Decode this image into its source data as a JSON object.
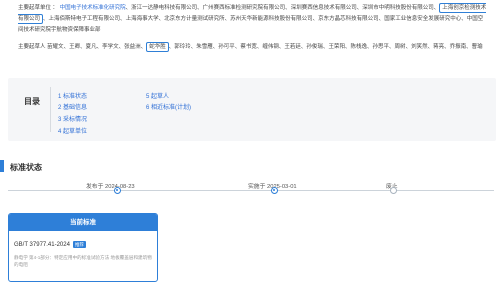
{
  "drafting_units": {
    "label": "主要起草单位",
    "orgs": [
      {
        "name": "中国电子技术标准化研究院",
        "link": true,
        "boxed": false
      },
      {
        "name": "浙江一达静电科技有限公司",
        "link": false,
        "boxed": false
      },
      {
        "name": "广州赛西标准检测研究院有限公司",
        "link": false,
        "boxed": false
      },
      {
        "name": "深圳赛西信息技术有限公司",
        "link": false,
        "boxed": false
      },
      {
        "name": "深圳市中明科技股份有限公司",
        "link": false,
        "boxed": false
      },
      {
        "name": "上海创京检测技术有限公司",
        "link": false,
        "boxed": true
      },
      {
        "name": "上海佰斯特电子工程有限公司",
        "link": false,
        "boxed": false
      },
      {
        "name": "上海海事大学",
        "link": false,
        "boxed": false
      },
      {
        "name": "北京东方计量测试研究所",
        "link": false,
        "boxed": false
      },
      {
        "name": "苏州天华新能源科技股份有限公司",
        "link": false,
        "boxed": false
      },
      {
        "name": "京东方晶芯科技有限公司",
        "link": false,
        "boxed": false
      },
      {
        "name": "国家工业信息安全发展研究中心",
        "link": false,
        "boxed": false
      },
      {
        "name": "中国空间技术研究院宇航物资保障事业部",
        "link": false,
        "boxed": false
      }
    ]
  },
  "drafters": {
    "label": "主要起草人",
    "names": [
      {
        "name": "苗耀文",
        "boxed": false
      },
      {
        "name": "王卿",
        "boxed": false
      },
      {
        "name": "夏凡",
        "boxed": false
      },
      {
        "name": "李学文",
        "boxed": false
      },
      {
        "name": "张益洲",
        "boxed": false
      },
      {
        "name": "蛇华胜",
        "boxed": true
      },
      {
        "name": "郭玲玲",
        "boxed": false
      },
      {
        "name": "朱雪雁",
        "boxed": false
      },
      {
        "name": "孙可平",
        "boxed": false
      },
      {
        "name": "蔡书宽",
        "boxed": false
      },
      {
        "name": "缠伟钢",
        "boxed": false
      },
      {
        "name": "王若廷",
        "boxed": false
      },
      {
        "name": "孙俊瑞",
        "boxed": false
      },
      {
        "name": "王荣阳",
        "boxed": false
      },
      {
        "name": "陈栈逸",
        "boxed": false
      },
      {
        "name": "孙思平",
        "boxed": false
      },
      {
        "name": "周树",
        "boxed": false
      },
      {
        "name": "刘笑然",
        "boxed": false
      },
      {
        "name": "蒋亮",
        "boxed": false
      },
      {
        "name": "乔振南",
        "boxed": false
      },
      {
        "name": "曹瑜",
        "boxed": false
      }
    ]
  },
  "toc": {
    "title": "目录",
    "items": [
      "1 标准状态",
      "2 基础信息",
      "3 采标情况",
      "4 起草单位",
      "5 起草人",
      "6 相近标准(计划)"
    ]
  },
  "status_section": {
    "title": "标准状态",
    "timeline": [
      {
        "label": "发布于 2024-08-23",
        "active": true
      },
      {
        "label": "实施于 2025-03-01",
        "active": true
      },
      {
        "label": "废止",
        "active": false
      }
    ]
  },
  "current_card": {
    "header": "当前标准",
    "code": "GB/T 37977.41-2024",
    "badge": "推荐",
    "description": "静电学 第4-1部分：特定应用中的标准试验方法 地板覆盖层和建筑物的电阻"
  },
  "colors": {
    "accent": "#2e7fd8",
    "link": "#2f6fd6"
  }
}
